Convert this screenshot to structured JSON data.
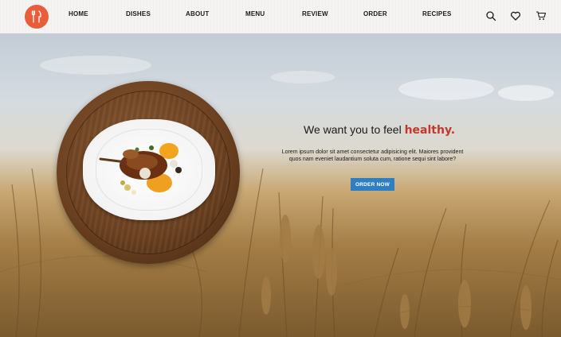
{
  "nav": {
    "items": [
      "HOME",
      "DISHES",
      "ABOUT",
      "MENU",
      "REVIEW",
      "ORDER",
      "RECIPES"
    ]
  },
  "icons": {
    "logo": "fork-knife-icon",
    "search": "search-icon",
    "favorite": "heart-icon",
    "cart": "cart-icon"
  },
  "hero": {
    "headline_prefix": "We want you to feel ",
    "headline_accent": "healthy.",
    "body": "Lorem ipsum dolor sit amet consectetur adipisicing elit. Maiores provident quos nam eveniet laudantium soluta cum, ratione sequi sint labore?",
    "cta": "ORDER NOW"
  },
  "colors": {
    "brand": "#e85d3a",
    "accent_text": "#c0392b",
    "button": "#2f7ec1"
  }
}
